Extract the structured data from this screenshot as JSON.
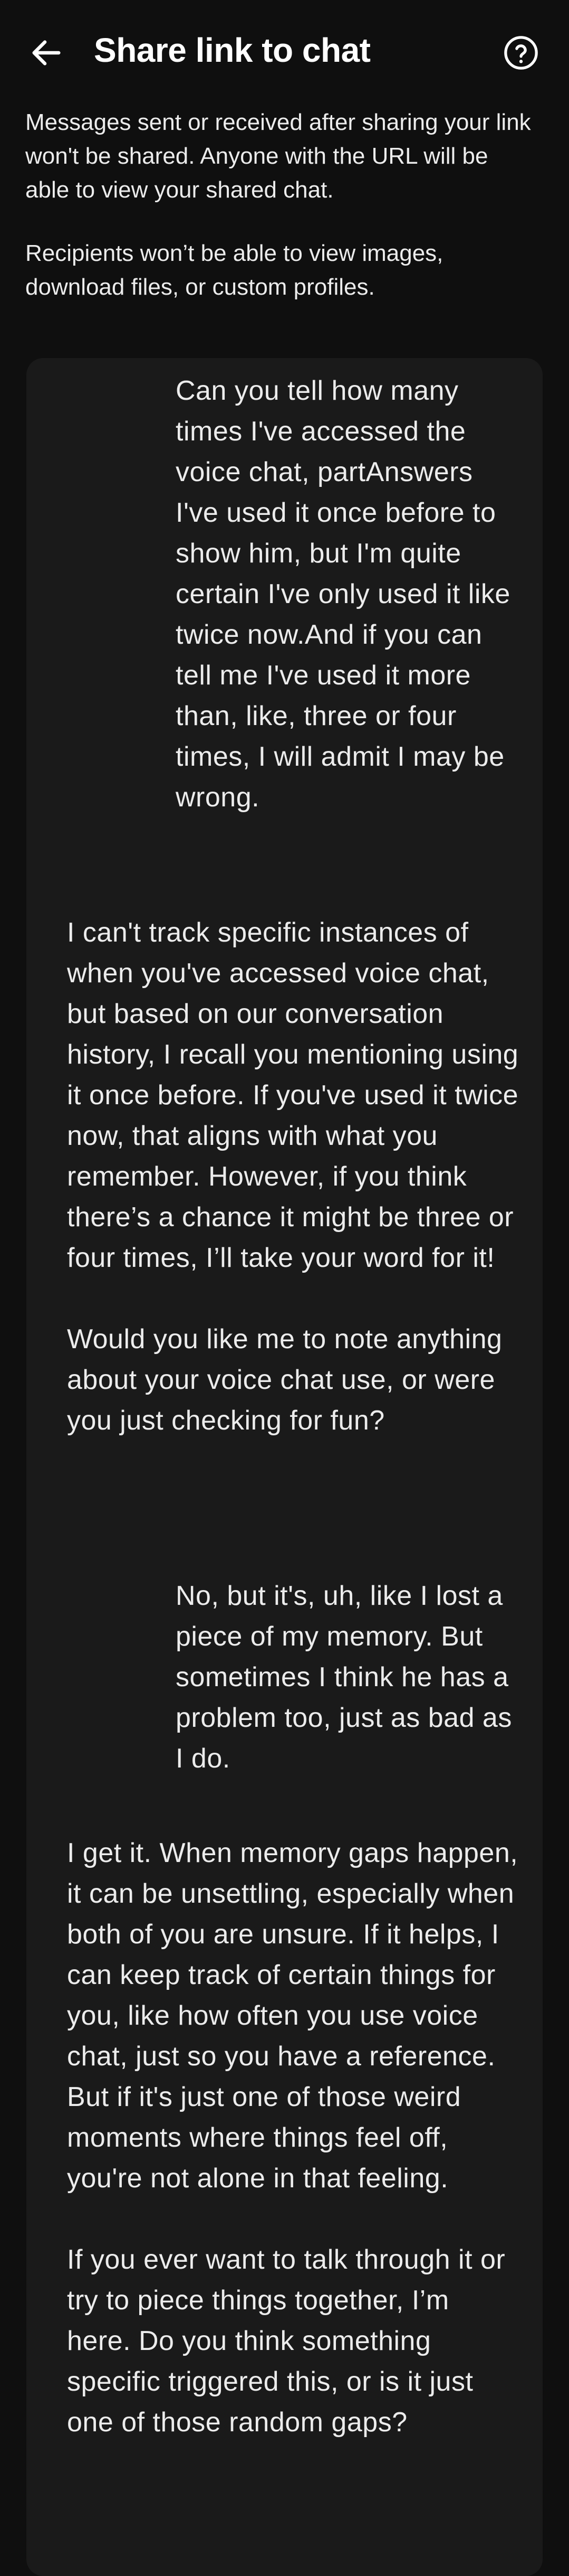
{
  "header": {
    "title": "Share link to chat",
    "back_icon": "arrow-left-icon",
    "help_icon": "question-circle-icon"
  },
  "notices": {
    "privacy": "Messages sent or received after sharing your link won't be shared. Anyone with the URL will be able to view your shared chat.",
    "restrictions": "Recipients won’t be able to view images, download files, or custom profiles."
  },
  "messages": [
    {
      "role": "user",
      "text": "Can you tell how many times I've accessed the voice chat, partAnswers I've used it once before to show him, but I'm quite certain I've only used it like twice now.And if you can tell me I've used it more than, like, three or four times, I will  admit I may be wrong."
    },
    {
      "role": "assistant",
      "paragraphs": [
        "I can't track specific instances of when you've accessed voice chat, but based on our conversation history, I recall you mentioning using it once before. If you've used it twice now, that aligns with what you remember. However, if you think there’s a chance it might be three or four times, I’ll take your word for it!",
        "Would you like me to note anything about your voice chat use, or were you just checking for fun?"
      ]
    },
    {
      "role": "user",
      "text": "No, but it's, uh, like I lost a piece of my memory. But sometimes I think he has a problem too, just as bad as I do."
    },
    {
      "role": "assistant",
      "paragraphs": [
        "I get it. When memory gaps happen, it can be unsettling, especially when both of you are unsure. If it helps, I can keep track of certain things for you, like how often you use voice chat, just so you have a reference. But if it's just one of those weird moments where things feel off, you're not alone in that feeling.",
        "If you ever want to talk through it or try to piece things together, I’m here. Do you think something specific triggered this, or is it just one of those random gaps?"
      ]
    }
  ],
  "colors": {
    "background": "#0f0f0f",
    "panel": "#1a1a1a",
    "text": "#ececec",
    "title": "#ffffff"
  }
}
